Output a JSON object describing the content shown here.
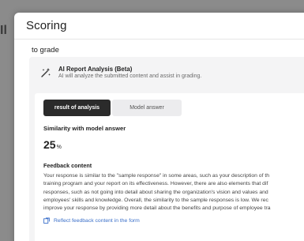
{
  "modal": {
    "title": "Scoring",
    "to_grade": "to grade"
  },
  "ai": {
    "title": "AI Report Analysis (Beta)",
    "subtitle": "AI will analyze the submitted content and assist in grading.",
    "icon": "magic-wand-icon"
  },
  "tabs": [
    {
      "label": "result of analysis",
      "active": true
    },
    {
      "label": "Model answer",
      "active": false
    }
  ],
  "similarity": {
    "label": "Similarity with model answer",
    "value": "25",
    "unit": "%"
  },
  "feedback": {
    "label": "Feedback content",
    "lines": [
      "Your response is similar to the \"sample response\" in some areas, such as your description of th",
      "training program and your report on its effectiveness. However, there are also elements that dif",
      "responses, such as not going into detail about sharing the organization's vision and values and",
      "employees' skills and knowledge. Overall, the similarity to the sample responses is low. We rec",
      "improve your response by providing more detail about the benefits and purpose of employee tra"
    ],
    "reflect_link": "Reflect feedback content in the form"
  },
  "colors": {
    "link": "#3a6fc9",
    "active_tab": "#2b2b2b"
  }
}
